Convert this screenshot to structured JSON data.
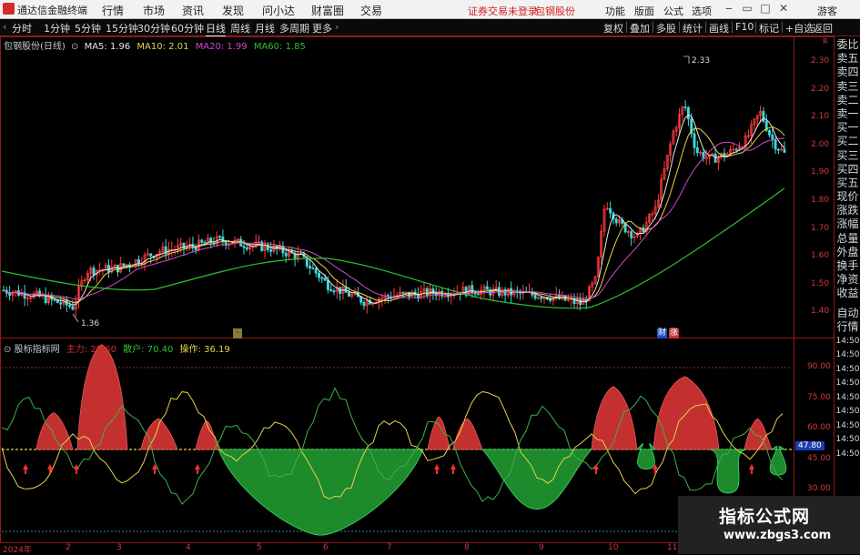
{
  "titlebar": {
    "app_title": "通达信金融终端",
    "menus": [
      "行情",
      "市场",
      "资讯",
      "发现",
      "问小达",
      "财富圈",
      "交易"
    ],
    "status": "证券交易未登录",
    "stock": "包钢股份",
    "right_menus": [
      "功能",
      "版面",
      "公式",
      "选项"
    ],
    "guest": "游客"
  },
  "toolbar": {
    "periods": [
      "分时",
      "1分钟",
      "5分钟",
      "15分钟",
      "30分钟",
      "60分钟",
      "日线",
      "周线",
      "月线",
      "多周期",
      "更多"
    ],
    "right_items": [
      "复权",
      "叠加",
      "多股",
      "统计",
      "画线",
      "F10",
      "标记",
      "+自选",
      "返回"
    ]
  },
  "main_legend": {
    "stock_name": "包钢股份(日线)",
    "ma5": "MA5: 1.96",
    "ma10": "MA10: 2.01",
    "ma20": "MA20: 1.99",
    "ma60": "MA60: 1.85"
  },
  "main_annotations": {
    "high": "2.33",
    "low": "1.36",
    "marker_finance": "财",
    "marker_up": "涨"
  },
  "price_axis": [
    "2.30",
    "2.20",
    "2.10",
    "2.00",
    "1.90",
    "1.80",
    "1.70",
    "1.60",
    "1.50",
    "1.40"
  ],
  "price_corner": "R",
  "sub_legend": {
    "name": "股标指标网",
    "main_force_label": "主力:",
    "main_force_value": "29.60",
    "retail_label": "散户:",
    "retail_value": "70.40",
    "operation_label": "操作:",
    "operation_value": "36.19"
  },
  "sub_axis": [
    "90.00",
    "75.00",
    "60.00",
    "45.00",
    "30.00"
  ],
  "sub_current": "47.80",
  "sidebar": {
    "main": [
      "委比",
      "卖五",
      "卖四",
      "卖三",
      "卖二",
      "卖一",
      "买一",
      "买二",
      "买三",
      "买四",
      "买五",
      "现价",
      "涨跌",
      "涨幅",
      "总量",
      "外盘",
      "换手",
      "净资",
      "收益"
    ],
    "sub": [
      "自动",
      "行情",
      "14:50",
      "14:50",
      "14:50",
      "14:50",
      "14:50",
      "14:50",
      "14:50",
      "14:50",
      "14:50"
    ]
  },
  "dates": [
    "2024年",
    "2",
    "3",
    "4",
    "5",
    "6",
    "7",
    "8",
    "9",
    "10",
    "11"
  ],
  "watermark": {
    "title": "指标公式网",
    "url": "www.zbgs3.com"
  },
  "colors": {
    "up": "#ff3b3b",
    "down": "#3fd9d9",
    "ma5": "#e8e8e8",
    "ma10": "#e6d24a",
    "ma20": "#d04ad0",
    "ma60": "#2fbf2f",
    "fill_red": "#c43030",
    "fill_green": "#1d8a2c",
    "yellow_line": "#e6d24a",
    "green_line": "#3fb04a"
  }
}
